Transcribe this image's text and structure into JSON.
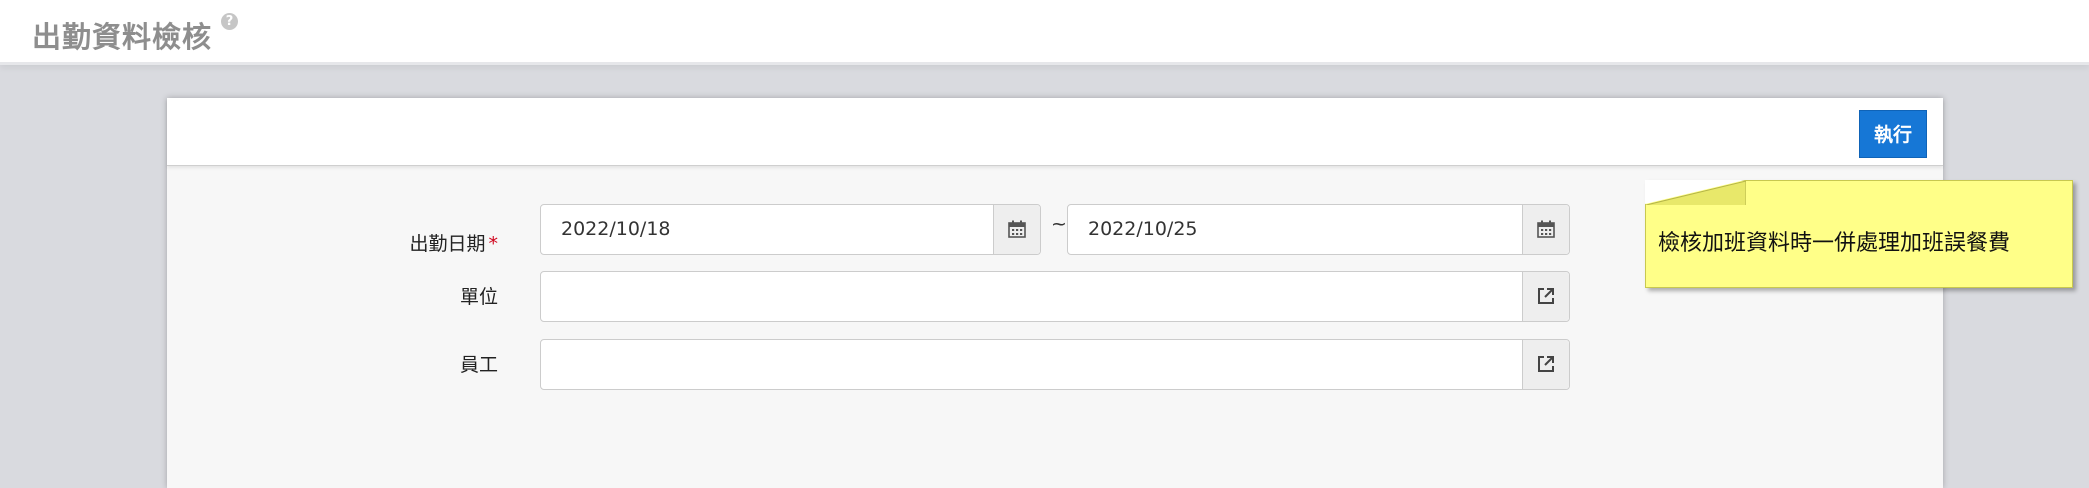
{
  "header": {
    "title": "出勤資料檢核",
    "help_icon": "help-circle-icon"
  },
  "toolbar": {
    "run_label": "執行",
    "accent_color": "#1677d6"
  },
  "form": {
    "date": {
      "label": "出勤日期",
      "required_mark": "*",
      "start_value": "2022/10/18",
      "separator": "~",
      "end_value": "2022/10/25",
      "icon": "calendar-icon"
    },
    "unit": {
      "label": "單位",
      "value": "",
      "icon": "open-popup-icon"
    },
    "employee": {
      "label": "員工",
      "value": "",
      "icon": "open-popup-icon"
    }
  },
  "note": {
    "text": "檢核加班資料時一併處理加班誤餐費",
    "color": "#ffff88"
  }
}
